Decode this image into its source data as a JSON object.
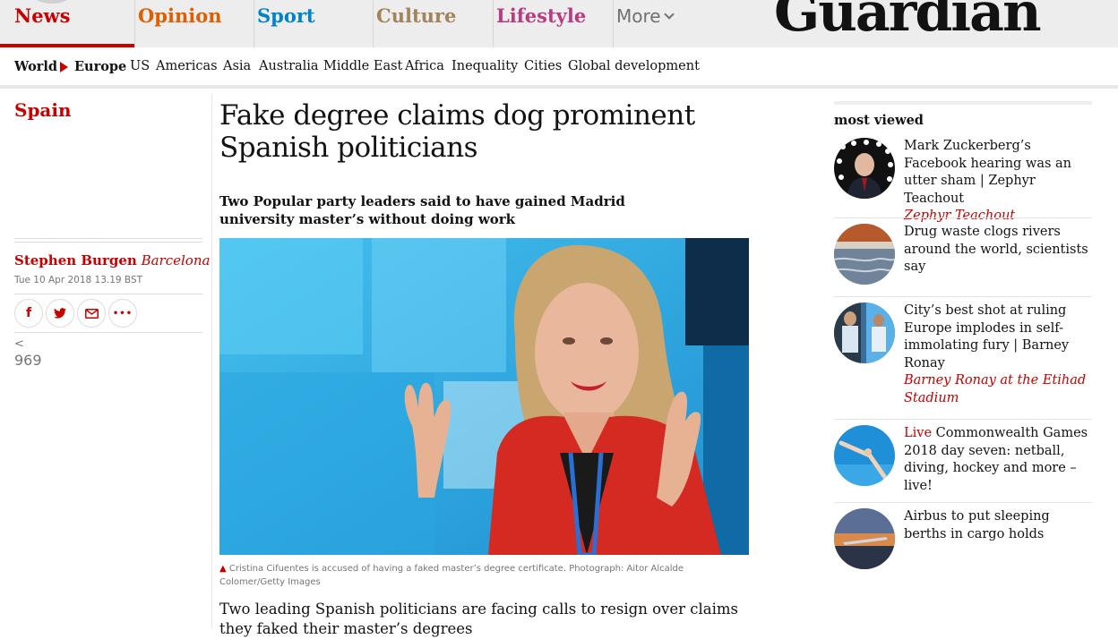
{
  "nav": {
    "pillars": [
      {
        "label": "News",
        "color": "#c70000"
      },
      {
        "label": "Opinion",
        "color": "#e05e00"
      },
      {
        "label": "Sport",
        "color": "#0084c6"
      },
      {
        "label": "Culture",
        "color": "#a1845c"
      },
      {
        "label": "Lifestyle",
        "color": "#bb3b80"
      }
    ],
    "more_label": "More",
    "brand": "Guardian"
  },
  "subnav": {
    "items": [
      "World",
      "Europe",
      "US",
      "Americas",
      "Asia",
      "Australia",
      "Middle East",
      "Africa",
      "Inequality",
      "Cities",
      "Global development"
    ]
  },
  "article": {
    "section": "Spain",
    "headline": "Fake degree claims dog prominent Spanish politicians",
    "standfirst": "Two Popular party leaders said to have gained Madrid university master’s without doing work",
    "author": "Stephen Burgen",
    "location": "Barcelona",
    "dateline": "Tue 10 Apr 2018 13.19 BST",
    "share_count": "969",
    "caption_marker": "▲",
    "caption": "Cristina Cifuentes is accused of having a faked master’s degree certificate. Photograph: Aitor Alcalde Colomer/Getty Images",
    "body": "Two leading Spanish politicians are facing calls to resign over claims they faked their master’s degrees"
  },
  "share": {
    "facebook": "f",
    "twitter_icon": "twitter-icon",
    "email_icon": "envelope-icon",
    "more": "•••"
  },
  "most_viewed": {
    "title": "most viewed",
    "items": [
      {
        "headline": "Mark Zuckerberg’s Facebook hearing was an utter sham | Zephyr Teachout",
        "byline": "Zephyr Teachout",
        "kicker": ""
      },
      {
        "headline": "Drug waste clogs rivers around the world, scientists say",
        "byline": "",
        "kicker": ""
      },
      {
        "headline": "City’s best shot at ruling Europe implodes in self-immolating fury | Barney Ronay",
        "byline": "Barney Ronay at the Etihad Stadium",
        "kicker": ""
      },
      {
        "headline": "Commonwealth Games 2018 day seven: netball, diving, hockey and more – live!",
        "byline": "",
        "kicker": "Live"
      },
      {
        "headline": "Airbus to put sleeping berths in cargo holds",
        "byline": "",
        "kicker": ""
      }
    ]
  },
  "colors": {
    "accent": "#c70000",
    "nav_background": "#ededed"
  }
}
